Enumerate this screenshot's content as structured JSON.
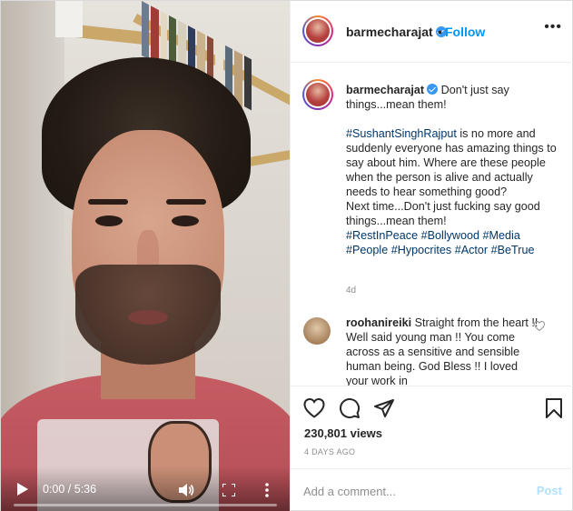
{
  "post": {
    "username": "barmecharajat",
    "follow_label": "Follow",
    "dot": "•",
    "more": "•••"
  },
  "caption": {
    "username": "barmecharajat",
    "first_line": "Don't just say things...mean them!",
    "body_start_tag": "#SushantSinghRajput",
    "body_text": " is no more and suddenly everyone has amazing things to say about him. Where are these people when the person is alive and actually needs to hear something good?",
    "line2": "Next time...Don't just fucking say good things...mean them!",
    "tags": [
      "#RestInPeace",
      "#Bollywood",
      "#Media",
      "#People",
      "#Hypocrites",
      "#Actor",
      "#BeTrue"
    ],
    "time": "4d"
  },
  "comment": {
    "username": "roohanireiki",
    "text": "Straight from the heart !! Well said young man !! You come across as a sensitive and sensible human being. God Bless !! I loved your work in"
  },
  "video": {
    "time_display": "0:00 / 5:36",
    "progress": 0.0
  },
  "stats": {
    "views": "230,801 views",
    "age": "4 DAYS AGO"
  },
  "add_comment": {
    "placeholder": "Add a comment...",
    "post_label": "Post"
  },
  "colors": {
    "link": "#00376b",
    "follow": "#0095f6",
    "post_disabled": "#b2dffc",
    "muted": "#8e8e8e"
  },
  "icons": [
    "verified-badge-icon",
    "more-icon",
    "heart-icon",
    "comment-icon",
    "share-icon",
    "save-icon",
    "play-icon",
    "volume-icon",
    "fullscreen-icon",
    "video-more-icon"
  ]
}
